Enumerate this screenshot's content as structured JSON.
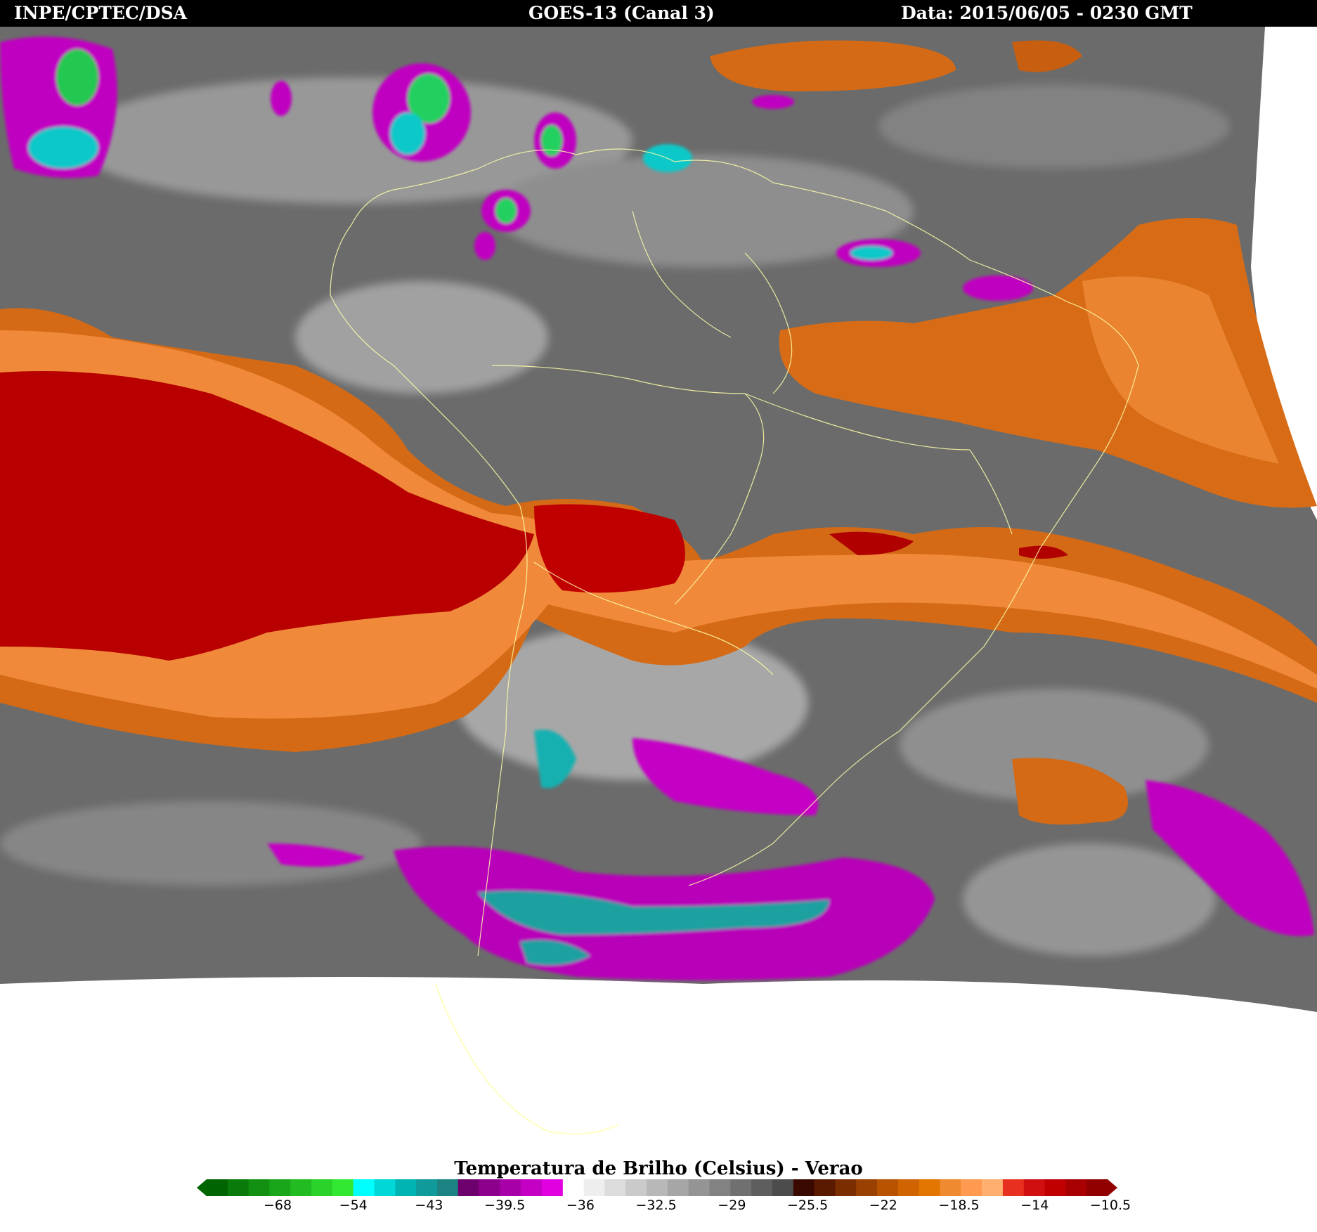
{
  "header": {
    "left": "INPE/CPTEC/DSA",
    "center": "GOES-13 (Canal 3)",
    "right": "Data: 2015/06/05 - 0230 GMT"
  },
  "legend": {
    "title": "Temperatura de Brilho (Celsius) - Verao",
    "ticks": [
      "−68",
      "−54",
      "−43",
      "−39.5",
      "−36",
      "−32.5",
      "−29",
      "−25.5",
      "−22",
      "−18.5",
      "−14",
      "−10.5"
    ],
    "colors": [
      "#006400",
      "#0a7a0a",
      "#129012",
      "#1aa61a",
      "#22bc22",
      "#2ad22a",
      "#33e833",
      "#00ffff",
      "#00d8d8",
      "#00b4b4",
      "#119a9a",
      "#1c8282",
      "#6e006e",
      "#8c008c",
      "#a800a8",
      "#c400c4",
      "#e000e0",
      "#ffffff",
      "#eeeeee",
      "#dcdcdc",
      "#cacaca",
      "#b8b8b8",
      "#a6a6a6",
      "#949494",
      "#828282",
      "#707070",
      "#5e5e5e",
      "#4c4c4c",
      "#3a0a00",
      "#5a1a00",
      "#7a2e00",
      "#9a4000",
      "#b85400",
      "#d06400",
      "#e27600",
      "#f08a30",
      "#ff9a50",
      "#ffb070",
      "#e83020",
      "#d01010",
      "#c00000",
      "#a80000",
      "#900000"
    ],
    "colors_note": ""
  },
  "map": {
    "land_colors": {
      "background_gray": "#6a6a6a",
      "cloud_light": "#e6e6e6",
      "orange": "#e0781e",
      "light_orange": "#ffa060",
      "red": "#c00000",
      "magenta": "#c400c4",
      "cyan": "#00c8c8",
      "green": "#22d022",
      "border_lines": "#ffffaa"
    }
  }
}
